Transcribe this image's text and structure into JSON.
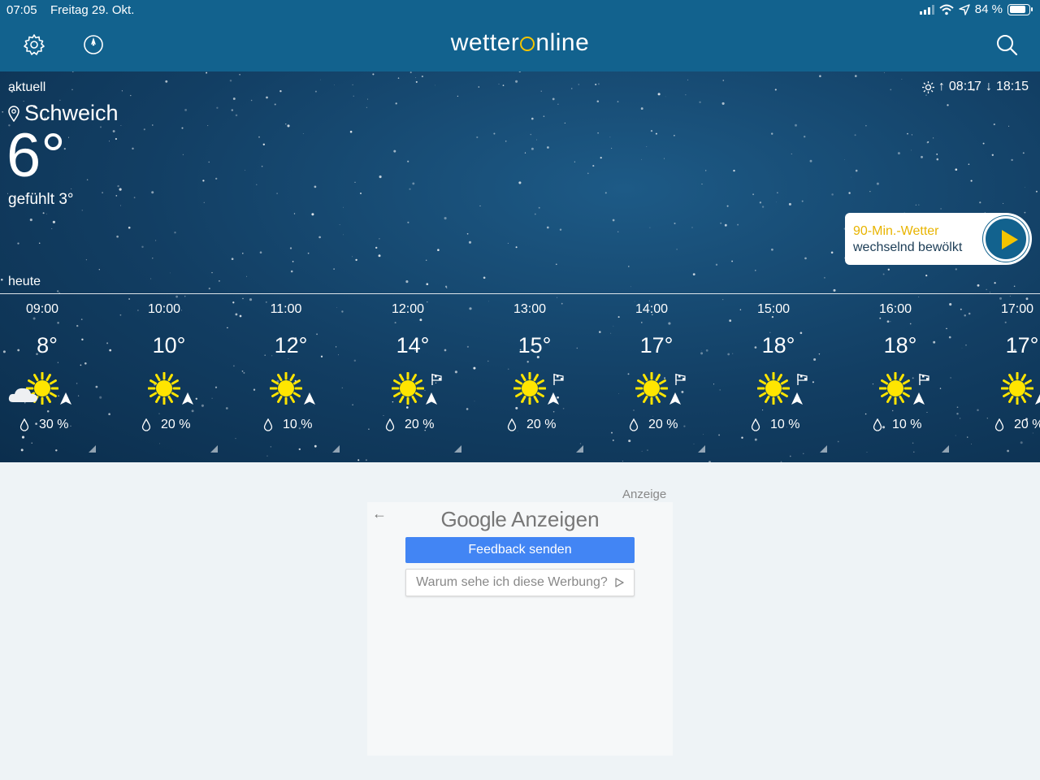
{
  "status_bar": {
    "time": "07:05",
    "date": "Freitag 29. Okt.",
    "battery": "84 %",
    "battery_level": 0.84
  },
  "header": {
    "logo_left": "wetter",
    "logo_right": "nline",
    "icons": [
      "gear-icon",
      "compass-icon",
      "search-icon"
    ],
    "background_color": "#12628e"
  },
  "current": {
    "label": "aktuell",
    "location": "Schweich",
    "temperature": "6°",
    "felt": "gefühlt 3°",
    "sunrise": "08:17",
    "sunset": "18:15"
  },
  "ninety_min": {
    "title": "90-Min.-Wetter",
    "subtitle": "wechselnd bewölkt",
    "accent_color": "#f4c400"
  },
  "today_label": "heute",
  "hourly": [
    {
      "time": "09:00",
      "temp": "8°",
      "rain": "30 %",
      "icon": "sun-cloud-icon",
      "gust": false
    },
    {
      "time": "10:00",
      "temp": "10°",
      "rain": "20 %",
      "icon": "sun-icon",
      "gust": false
    },
    {
      "time": "11:00",
      "temp": "12°",
      "rain": "10 %",
      "icon": "sun-icon",
      "gust": false
    },
    {
      "time": "12:00",
      "temp": "14°",
      "rain": "20 %",
      "icon": "sun-icon",
      "gust": true
    },
    {
      "time": "13:00",
      "temp": "15°",
      "rain": "20 %",
      "icon": "sun-icon",
      "gust": true
    },
    {
      "time": "14:00",
      "temp": "17°",
      "rain": "20 %",
      "icon": "sun-icon",
      "gust": true
    },
    {
      "time": "15:00",
      "temp": "18°",
      "rain": "10 %",
      "icon": "sun-icon",
      "gust": true
    },
    {
      "time": "16:00",
      "temp": "18°",
      "rain": "10 %",
      "icon": "sun-icon",
      "gust": true
    },
    {
      "time": "17:00",
      "temp": "17°",
      "rain": "20 %",
      "icon": "sun-icon",
      "gust": true
    }
  ],
  "ad": {
    "label": "Anzeige",
    "brand": "Google",
    "brand_suffix": "Anzeigen",
    "feedback_button": "Feedback senden",
    "why_text": "Warum sehe ich diese Werbung?",
    "button_color": "#4285f4"
  }
}
